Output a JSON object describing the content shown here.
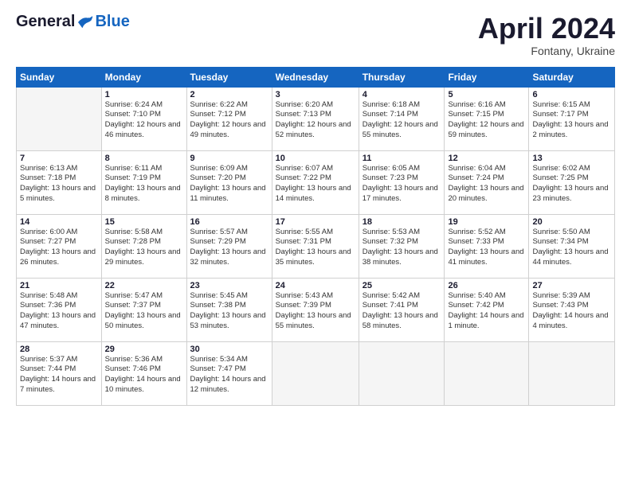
{
  "header": {
    "logo_general": "General",
    "logo_blue": "Blue",
    "month_title": "April 2024",
    "subtitle": "Fontany, Ukraine"
  },
  "weekdays": [
    "Sunday",
    "Monday",
    "Tuesday",
    "Wednesday",
    "Thursday",
    "Friday",
    "Saturday"
  ],
  "weeks": [
    [
      {
        "day": "",
        "empty": true
      },
      {
        "day": "1",
        "sunrise": "Sunrise: 6:24 AM",
        "sunset": "Sunset: 7:10 PM",
        "daylight": "Daylight: 12 hours and 46 minutes."
      },
      {
        "day": "2",
        "sunrise": "Sunrise: 6:22 AM",
        "sunset": "Sunset: 7:12 PM",
        "daylight": "Daylight: 12 hours and 49 minutes."
      },
      {
        "day": "3",
        "sunrise": "Sunrise: 6:20 AM",
        "sunset": "Sunset: 7:13 PM",
        "daylight": "Daylight: 12 hours and 52 minutes."
      },
      {
        "day": "4",
        "sunrise": "Sunrise: 6:18 AM",
        "sunset": "Sunset: 7:14 PM",
        "daylight": "Daylight: 12 hours and 55 minutes."
      },
      {
        "day": "5",
        "sunrise": "Sunrise: 6:16 AM",
        "sunset": "Sunset: 7:15 PM",
        "daylight": "Daylight: 12 hours and 59 minutes."
      },
      {
        "day": "6",
        "sunrise": "Sunrise: 6:15 AM",
        "sunset": "Sunset: 7:17 PM",
        "daylight": "Daylight: 13 hours and 2 minutes."
      }
    ],
    [
      {
        "day": "7",
        "sunrise": "Sunrise: 6:13 AM",
        "sunset": "Sunset: 7:18 PM",
        "daylight": "Daylight: 13 hours and 5 minutes."
      },
      {
        "day": "8",
        "sunrise": "Sunrise: 6:11 AM",
        "sunset": "Sunset: 7:19 PM",
        "daylight": "Daylight: 13 hours and 8 minutes."
      },
      {
        "day": "9",
        "sunrise": "Sunrise: 6:09 AM",
        "sunset": "Sunset: 7:20 PM",
        "daylight": "Daylight: 13 hours and 11 minutes."
      },
      {
        "day": "10",
        "sunrise": "Sunrise: 6:07 AM",
        "sunset": "Sunset: 7:22 PM",
        "daylight": "Daylight: 13 hours and 14 minutes."
      },
      {
        "day": "11",
        "sunrise": "Sunrise: 6:05 AM",
        "sunset": "Sunset: 7:23 PM",
        "daylight": "Daylight: 13 hours and 17 minutes."
      },
      {
        "day": "12",
        "sunrise": "Sunrise: 6:04 AM",
        "sunset": "Sunset: 7:24 PM",
        "daylight": "Daylight: 13 hours and 20 minutes."
      },
      {
        "day": "13",
        "sunrise": "Sunrise: 6:02 AM",
        "sunset": "Sunset: 7:25 PM",
        "daylight": "Daylight: 13 hours and 23 minutes."
      }
    ],
    [
      {
        "day": "14",
        "sunrise": "Sunrise: 6:00 AM",
        "sunset": "Sunset: 7:27 PM",
        "daylight": "Daylight: 13 hours and 26 minutes."
      },
      {
        "day": "15",
        "sunrise": "Sunrise: 5:58 AM",
        "sunset": "Sunset: 7:28 PM",
        "daylight": "Daylight: 13 hours and 29 minutes."
      },
      {
        "day": "16",
        "sunrise": "Sunrise: 5:57 AM",
        "sunset": "Sunset: 7:29 PM",
        "daylight": "Daylight: 13 hours and 32 minutes."
      },
      {
        "day": "17",
        "sunrise": "Sunrise: 5:55 AM",
        "sunset": "Sunset: 7:31 PM",
        "daylight": "Daylight: 13 hours and 35 minutes."
      },
      {
        "day": "18",
        "sunrise": "Sunrise: 5:53 AM",
        "sunset": "Sunset: 7:32 PM",
        "daylight": "Daylight: 13 hours and 38 minutes."
      },
      {
        "day": "19",
        "sunrise": "Sunrise: 5:52 AM",
        "sunset": "Sunset: 7:33 PM",
        "daylight": "Daylight: 13 hours and 41 minutes."
      },
      {
        "day": "20",
        "sunrise": "Sunrise: 5:50 AM",
        "sunset": "Sunset: 7:34 PM",
        "daylight": "Daylight: 13 hours and 44 minutes."
      }
    ],
    [
      {
        "day": "21",
        "sunrise": "Sunrise: 5:48 AM",
        "sunset": "Sunset: 7:36 PM",
        "daylight": "Daylight: 13 hours and 47 minutes."
      },
      {
        "day": "22",
        "sunrise": "Sunrise: 5:47 AM",
        "sunset": "Sunset: 7:37 PM",
        "daylight": "Daylight: 13 hours and 50 minutes."
      },
      {
        "day": "23",
        "sunrise": "Sunrise: 5:45 AM",
        "sunset": "Sunset: 7:38 PM",
        "daylight": "Daylight: 13 hours and 53 minutes."
      },
      {
        "day": "24",
        "sunrise": "Sunrise: 5:43 AM",
        "sunset": "Sunset: 7:39 PM",
        "daylight": "Daylight: 13 hours and 55 minutes."
      },
      {
        "day": "25",
        "sunrise": "Sunrise: 5:42 AM",
        "sunset": "Sunset: 7:41 PM",
        "daylight": "Daylight: 13 hours and 58 minutes."
      },
      {
        "day": "26",
        "sunrise": "Sunrise: 5:40 AM",
        "sunset": "Sunset: 7:42 PM",
        "daylight": "Daylight: 14 hours and 1 minute."
      },
      {
        "day": "27",
        "sunrise": "Sunrise: 5:39 AM",
        "sunset": "Sunset: 7:43 PM",
        "daylight": "Daylight: 14 hours and 4 minutes."
      }
    ],
    [
      {
        "day": "28",
        "sunrise": "Sunrise: 5:37 AM",
        "sunset": "Sunset: 7:44 PM",
        "daylight": "Daylight: 14 hours and 7 minutes."
      },
      {
        "day": "29",
        "sunrise": "Sunrise: 5:36 AM",
        "sunset": "Sunset: 7:46 PM",
        "daylight": "Daylight: 14 hours and 10 minutes."
      },
      {
        "day": "30",
        "sunrise": "Sunrise: 5:34 AM",
        "sunset": "Sunset: 7:47 PM",
        "daylight": "Daylight: 14 hours and 12 minutes."
      },
      {
        "day": "",
        "empty": true
      },
      {
        "day": "",
        "empty": true
      },
      {
        "day": "",
        "empty": true
      },
      {
        "day": "",
        "empty": true
      }
    ]
  ]
}
